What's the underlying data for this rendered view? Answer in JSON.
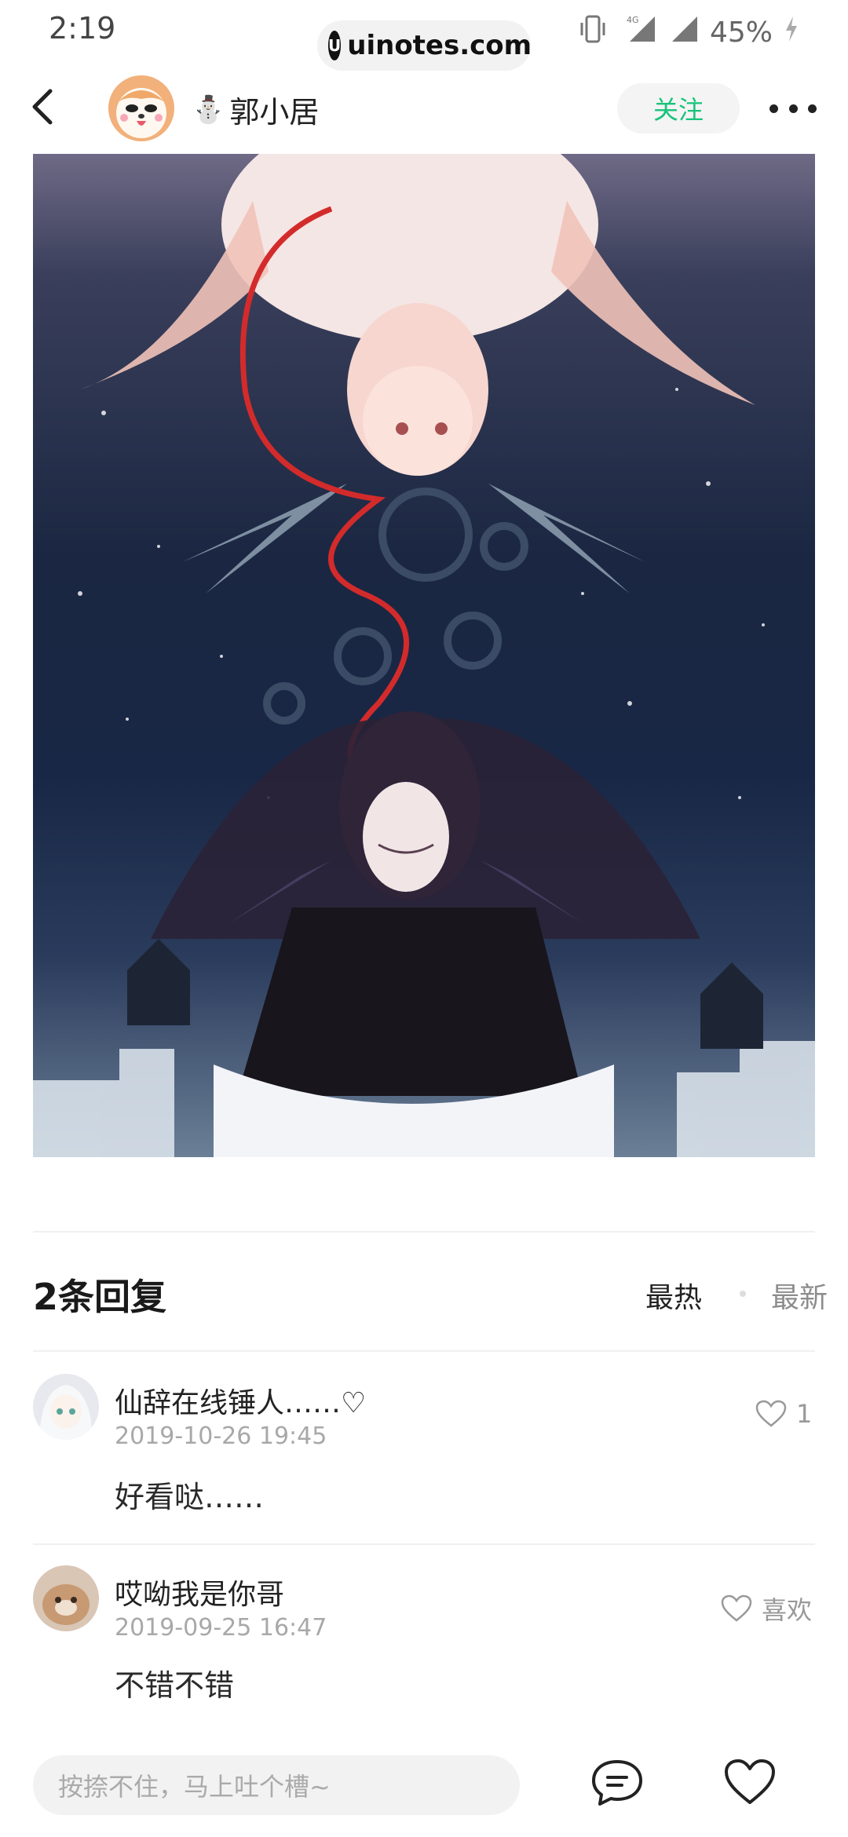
{
  "status": {
    "time": "2:19",
    "network": "4G",
    "battery": "45%",
    "watermark": "uinotes.com"
  },
  "header": {
    "username": "郭小居",
    "follow_label": "关注",
    "snowman_icon": "⛄"
  },
  "replies": {
    "title": "2条回复",
    "sort_hot": "最热",
    "sort_new": "最新",
    "comments": [
      {
        "name": "仙辞在线锤人……♡",
        "time": "2019-10-26 19:45",
        "text": "好看哒……",
        "like_label": "1"
      },
      {
        "name": "哎呦我是你哥",
        "time": "2019-09-25 16:47",
        "text": "不错不错",
        "like_label": "喜欢"
      }
    ]
  },
  "bottom": {
    "input_placeholder": "按捺不住，马上吐个槽~"
  },
  "colors": {
    "accent": "#17c37a",
    "muted": "#a8a8a8"
  }
}
